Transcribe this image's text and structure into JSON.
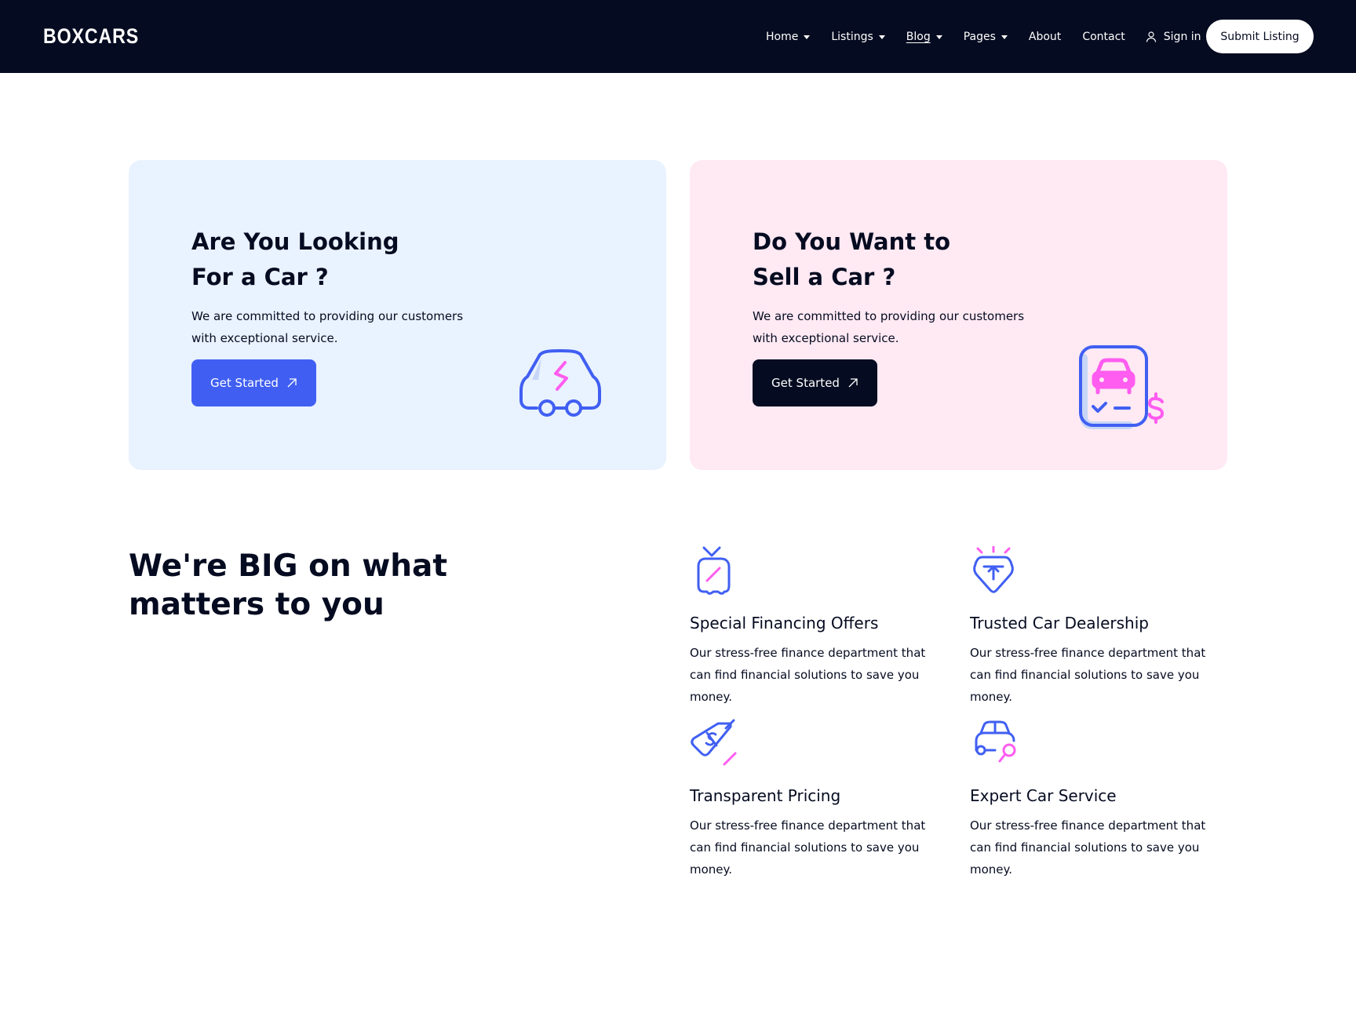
{
  "header": {
    "logo": "BOXCARS",
    "nav": [
      {
        "label": "Home",
        "dropdown": true
      },
      {
        "label": "Listings",
        "dropdown": true
      },
      {
        "label": "Blog",
        "dropdown": true
      },
      {
        "label": "Pages",
        "dropdown": true
      },
      {
        "label": "About",
        "dropdown": false
      },
      {
        "label": "Contact",
        "dropdown": false
      }
    ],
    "signin_label": "Sign in",
    "submit_label": "Submit Listing"
  },
  "cards": [
    {
      "title_line1": "Are You Looking",
      "title_line2": "For a Car ?",
      "text": "We are committed to providing our customers with exceptional service.",
      "button": "Get Started",
      "icon": "electric-car-icon"
    },
    {
      "title_line1": "Do You Want to",
      "title_line2": "Sell a Car ?",
      "text": "We are committed to providing our customers with exceptional service.",
      "button": "Get Started",
      "icon": "sell-car-document-icon"
    }
  ],
  "features_section": {
    "title_line1": "We're BIG on what",
    "title_line2": "matters to you",
    "items": [
      {
        "title": "Special Financing Offers",
        "text": "Our stress-free finance department that can find financial solutions to save you money.",
        "icon": "financing-tag-icon"
      },
      {
        "title": "Trusted Car Dealership",
        "text": "Our stress-free finance department that can find financial solutions to save you money.",
        "icon": "diamond-badge-icon"
      },
      {
        "title": "Transparent Pricing",
        "text": "Our stress-free finance department that can find financial solutions to save you money.",
        "icon": "price-tag-icon"
      },
      {
        "title": "Expert Car Service",
        "text": "Our stress-free finance department that can find financial solutions to save you money.",
        "icon": "car-service-icon"
      }
    ]
  },
  "colors": {
    "navy": "#050b20",
    "accent_blue": "#405ff2",
    "accent_pink": "#ff5cf0",
    "card_blue_bg": "#e9f2ff",
    "card_pink_bg": "#ffe9f3"
  }
}
